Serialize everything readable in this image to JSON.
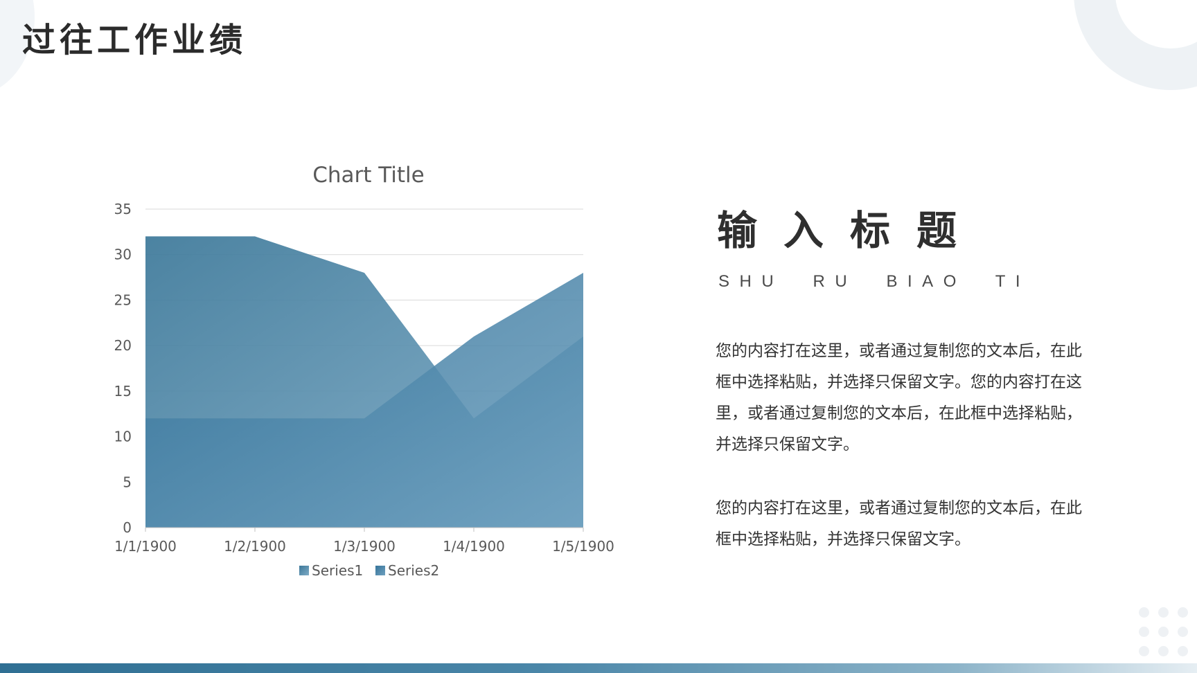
{
  "page": {
    "title": "过往工作业绩"
  },
  "side": {
    "heading": "输入标题",
    "subheading": "SHU  RU  BIAO  TI",
    "paragraph1": "您的内容打在这里，或者通过复制您的文本后，在此框中选择粘贴，并选择只保留文字。您的内容打在这里，或者通过复制您的文本后，在此框中选择粘贴，并选择只保留文字。",
    "paragraph2": "您的内容打在这里，或者通过复制您的文本后，在此框中选择粘贴，并选择只保留文字。"
  },
  "colors": {
    "accent": "#3b789c",
    "series1_start": "#3c7899",
    "series1_end": "#7eabc6",
    "series2_start": "#36749a",
    "series2_end": "#6ea0bf",
    "text_dark": "#2b2b2b"
  },
  "chart_data": {
    "type": "area",
    "title": "Chart Title",
    "categories": [
      "1/1/1900",
      "1/2/1900",
      "1/3/1900",
      "1/4/1900",
      "1/5/1900"
    ],
    "series": [
      {
        "name": "Series1",
        "values": [
          32,
          32,
          28,
          12,
          21
        ]
      },
      {
        "name": "Series2",
        "values": [
          12,
          12,
          12,
          21,
          28
        ]
      }
    ],
    "xlabel": "",
    "ylabel": "",
    "ylim": [
      0,
      35
    ],
    "yticks": [
      0,
      5,
      10,
      15,
      20,
      25,
      30,
      35
    ],
    "grid": true,
    "legend": "bottom"
  }
}
